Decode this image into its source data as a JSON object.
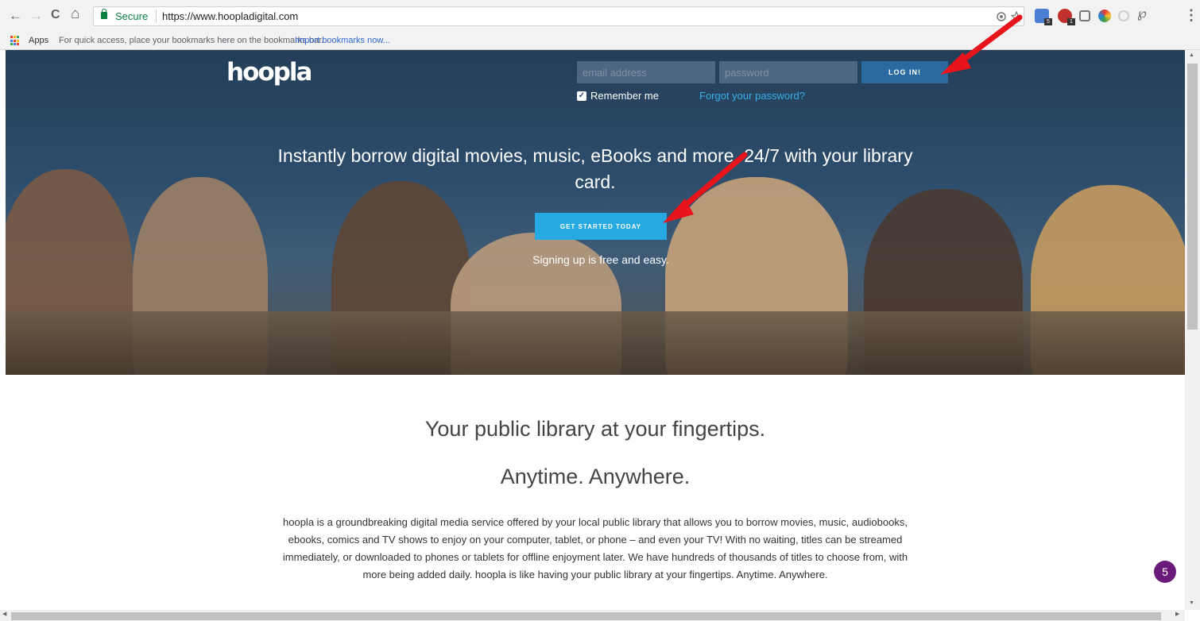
{
  "browser": {
    "back_glyph": "←",
    "forward_glyph": "→",
    "reload_glyph": "C",
    "home_glyph": "⌂",
    "secure_label": "Secure",
    "url": "https://www.hoopladigital.com",
    "menu_glyph": "⋮",
    "extension_badges": [
      "5",
      "1"
    ]
  },
  "bookmarks": {
    "apps_label": "Apps",
    "hint": "For quick access, place your bookmarks here on the bookmarks bar.",
    "import_link": "Import bookmarks now..."
  },
  "header": {
    "logo": "hoopla",
    "email_placeholder": "email address",
    "password_placeholder": "password",
    "login_label": "LOG IN!",
    "remember_label": "Remember me",
    "remember_check": "✓",
    "forgot_label": "Forgot your password?"
  },
  "hero": {
    "headline": "Instantly borrow digital movies, music, eBooks and more, 24/7 with your library card.",
    "cta_label": "GET STARTED TODAY",
    "subline": "Signing up is free and easy."
  },
  "content": {
    "tagline1": "Your public library at your fingertips.",
    "tagline2": "Anytime. Anywhere.",
    "body": "hoopla is a groundbreaking digital media service offered by your local public library that allows you to borrow movies, music, audiobooks, ebooks, comics and TV shows to enjoy on your computer, tablet, or phone – and even your TV! With no waiting, titles can be streamed immediately, or downloaded to phones or tablets for offline enjoyment later. We have hundreds of thousands of titles to choose from, with more being added daily. hoopla is like having your public library at your fingertips. Anytime. Anywhere."
  },
  "chat": {
    "count": "5"
  },
  "colors": {
    "hero_accent": "#27aae1",
    "login_button": "#2b6aa1",
    "annotation_arrow": "#e8141b",
    "chat_badge": "#6a1b7a"
  }
}
